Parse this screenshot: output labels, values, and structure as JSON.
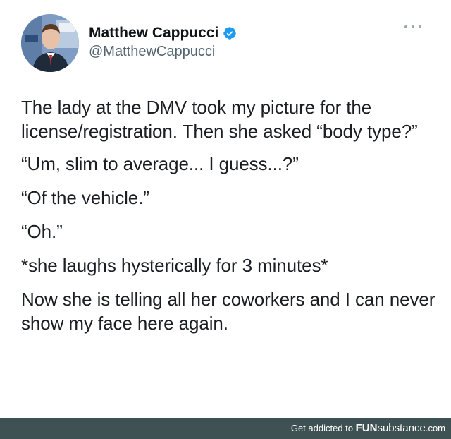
{
  "author": {
    "display_name": "Matthew Cappucci",
    "handle": "@MatthewCappucci",
    "verified_icon": "verified-badge-icon",
    "avatar_icon": "profile-photo-avatar"
  },
  "tweet": {
    "paragraphs": [
      "The lady at the DMV took my picture for the license/registration. Then she asked “body type?”",
      "“Um, slim to average... I guess...?”",
      "“Of the vehicle.”",
      "“Oh.”",
      "*she laughs hysterically for 3 minutes*",
      "Now she is telling all her coworkers and I can never show my face here again."
    ]
  },
  "footer": {
    "prefix": "Get addicted to ",
    "brand_fun": "FUN",
    "brand_substance": "substance",
    "brand_tld": ".com"
  },
  "colors": {
    "verified": "#1d9bf0",
    "footer_bg": "#3e5254",
    "handle": "#536471"
  }
}
